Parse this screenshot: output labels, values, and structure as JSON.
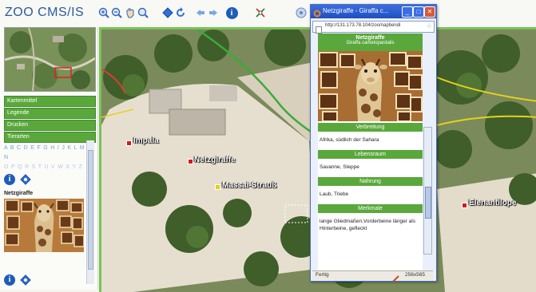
{
  "app": {
    "title": "ZOO CMS/IS"
  },
  "toolbar": {
    "icons": [
      "zoom-in-icon",
      "zoom-out-icon",
      "pan-icon",
      "search-map-icon",
      "navigate-icon",
      "refresh-icon",
      "back-icon",
      "forward-icon",
      "info-icon",
      "measure-icon"
    ]
  },
  "left_panel": {
    "menu": [
      "Kartenmittel",
      "Legende",
      "Drucken",
      "Tierarten"
    ],
    "alphabet_row1": "A B C D E F G H I J K L M N",
    "alphabet_row2": "O P Q R S T U V W X Y Z",
    "selected_animal": "Netzgiraffe"
  },
  "map": {
    "labels": [
      "Impala",
      "Netzgiraffe",
      "Massai-Strauß",
      "Elenantilope"
    ]
  },
  "popup": {
    "window_title": "Netzgiraffe - Giraffa c...",
    "url": "http://131.173.78.104/zoo/napbendi",
    "animal_name": "Netzgiraffe",
    "scientific_name": "Giraffa camelopardalis",
    "sections": [
      {
        "title": "Verbreitung",
        "text": "Afrika, südlich der Sahara"
      },
      {
        "title": "Lebensraum",
        "text": "Savanne, Steppe"
      },
      {
        "title": "Nahrung",
        "text": "Laub, Triebe"
      },
      {
        "title": "Merkmale",
        "text": "lange Gliedmaßen,Vorderbeine länger als Hinterbeine, gefleckt"
      }
    ],
    "status_left": "Fertig",
    "status_right": "256x565"
  },
  "colors": {
    "accent_green": "#5aa83c",
    "title_blue": "#2a5a9e",
    "popup_titlebar": "#1f4fc0",
    "marker_red": "#d21b1b"
  }
}
